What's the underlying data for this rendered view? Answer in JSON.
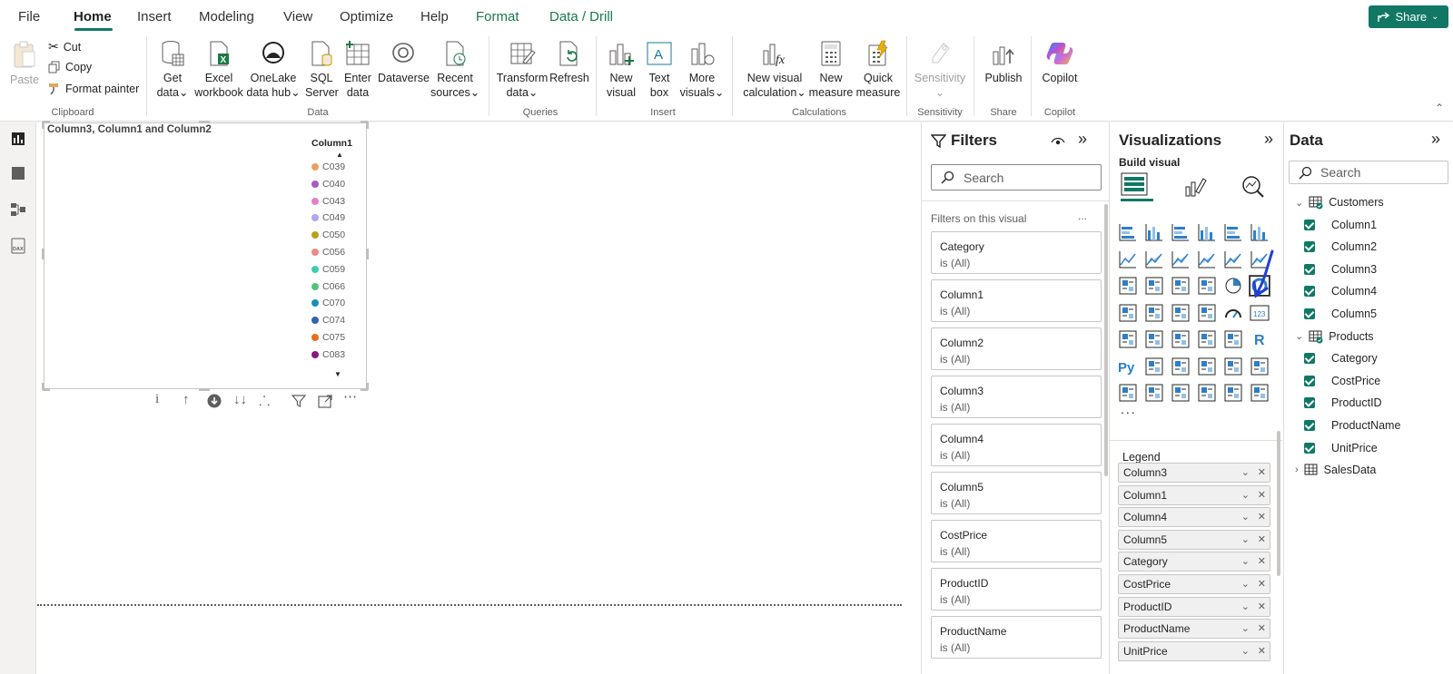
{
  "menu": {
    "items": [
      "File",
      "Home",
      "Insert",
      "Modeling",
      "View",
      "Optimize",
      "Help",
      "Format",
      "Data / Drill"
    ],
    "share_label": "Share"
  },
  "ribbon": {
    "clipboard": {
      "paste": "Paste",
      "cut": "Cut",
      "copy": "Copy",
      "format_painter": "Format painter",
      "label": "Clipboard"
    },
    "data": {
      "get_data_1": "Get",
      "get_data_2": "data",
      "excel_1": "Excel",
      "excel_2": "workbook",
      "onelake_1": "OneLake",
      "onelake_2": "data hub",
      "sql_1": "SQL",
      "sql_2": "Server",
      "enter_1": "Enter",
      "enter_2": "data",
      "dataverse": "Dataverse",
      "recent_1": "Recent",
      "recent_2": "sources",
      "label": "Data"
    },
    "queries": {
      "transform_1": "Transform",
      "transform_2": "data",
      "refresh": "Refresh",
      "label": "Queries"
    },
    "insert": {
      "new_visual_1": "New",
      "new_visual_2": "visual",
      "text_box_1": "Text",
      "text_box_2": "box",
      "more_visuals_1": "More",
      "more_visuals_2": "visuals",
      "label": "Insert"
    },
    "calculations": {
      "new_visual_calc_1": "New visual",
      "new_visual_calc_2": "calculation",
      "new_measure_1": "New",
      "new_measure_2": "measure",
      "quick_measure_1": "Quick",
      "quick_measure_2": "measure",
      "label": "Calculations"
    },
    "sensitivity": {
      "button": "Sensitivity",
      "label": "Sensitivity"
    },
    "share": {
      "publish": "Publish",
      "label": "Share"
    },
    "copilot": {
      "button": "Copilot",
      "label": "Copilot"
    }
  },
  "visual": {
    "title": "Column3, Column1 and Column2",
    "legend_title": "Column1",
    "legend_items": [
      {
        "label": "C039",
        "color": "#e8a262"
      },
      {
        "label": "C040",
        "color": "#a55bbf"
      },
      {
        "label": "C043",
        "color": "#e27fc9"
      },
      {
        "label": "C049",
        "color": "#b3a5e8"
      },
      {
        "label": "C050",
        "color": "#b8a020"
      },
      {
        "label": "C056",
        "color": "#ee8a8a"
      },
      {
        "label": "C059",
        "color": "#3dcfb0"
      },
      {
        "label": "C066",
        "color": "#52c479"
      },
      {
        "label": "C070",
        "color": "#1a8fb5"
      },
      {
        "label": "C074",
        "color": "#3b5fa8"
      },
      {
        "label": "C075",
        "color": "#ea6c1d"
      },
      {
        "label": "C083",
        "color": "#8b1a7d"
      }
    ]
  },
  "filters": {
    "title": "Filters",
    "search_placeholder": "Search",
    "section": "Filters on this visual",
    "more": "...",
    "cards": [
      {
        "name": "Category",
        "state": "is (All)"
      },
      {
        "name": "Column1",
        "state": "is (All)"
      },
      {
        "name": "Column2",
        "state": "is (All)"
      },
      {
        "name": "Column3",
        "state": "is (All)"
      },
      {
        "name": "Column4",
        "state": "is (All)"
      },
      {
        "name": "Column5",
        "state": "is (All)"
      },
      {
        "name": "CostPrice",
        "state": "is (All)"
      },
      {
        "name": "ProductID",
        "state": "is (All)"
      },
      {
        "name": "ProductName",
        "state": "is (All)"
      }
    ]
  },
  "visualizations": {
    "title": "Visualizations",
    "build_visual": "Build visual",
    "legend_label": "Legend",
    "more": "...",
    "wells": [
      "Column3",
      "Column1",
      "Column4",
      "Column5",
      "Category",
      "CostPrice",
      "ProductID",
      "ProductName",
      "UnitPrice"
    ]
  },
  "data": {
    "title": "Data",
    "search_placeholder": "Search",
    "tables": [
      {
        "name": "Customers",
        "fields": [
          "Column1",
          "Column2",
          "Column3",
          "Column4",
          "Column5"
        ]
      },
      {
        "name": "Products",
        "fields": [
          "Category",
          "CostPrice",
          "ProductID",
          "ProductName",
          "UnitPrice"
        ]
      },
      {
        "name": "SalesData",
        "fields": []
      }
    ]
  },
  "colors": {
    "accent": "#117865",
    "format_tab": "#1a7a4c",
    "annotation_arrow": "#1f3fd6"
  }
}
